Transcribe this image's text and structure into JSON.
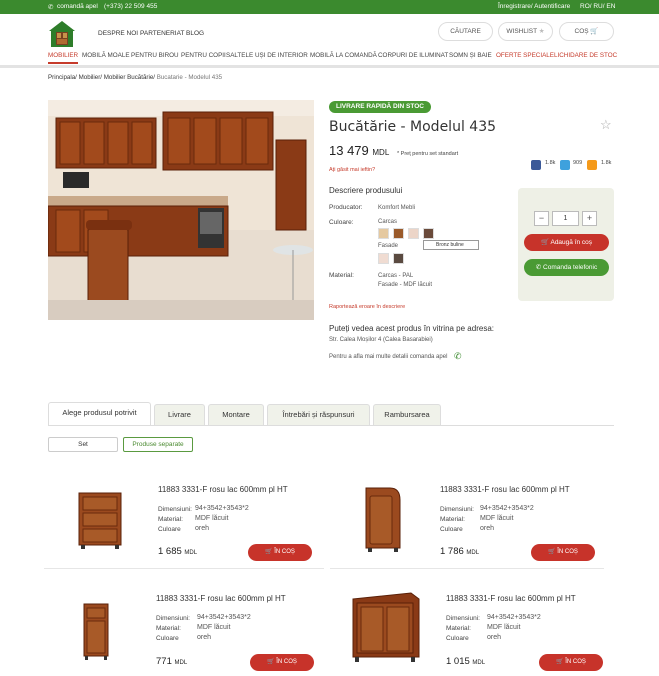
{
  "topbar": {
    "callback": "comandă apel",
    "phone": "(+373) 22 509 455",
    "auth": "Înregistrare/ Autentificare",
    "langs": "RO/ RU/ EN"
  },
  "header": {
    "links": [
      "DESPRE NOI",
      "PARTENERIAT",
      "BLOG"
    ],
    "search": "CĂUTARE",
    "wishlist": "WISHLIST",
    "cart": "COȘ"
  },
  "nav": [
    "MOBILIER",
    "MOBILĂ MOALE",
    "PENTRU BIROU",
    "PENTRU COPII",
    "SALTELE",
    "UȘI DE INTERIOR",
    "MOBILĂ LA COMANDĂ",
    "CORPURI DE ILUMINAT",
    "SOMN ȘI BAIE",
    "OFERTE SPECIALE",
    "LICHIDARE DE STOC"
  ],
  "breadcrumb": [
    "Principala/",
    "Mobilier/",
    "Mobilier Bucătărie/",
    "Bucatarie - Modelul 435"
  ],
  "product": {
    "badge": "LIVRARE RAPIDĂ DIN STOC",
    "title": "Bucătărie - Modelul 435",
    "price": "13 479",
    "currency": "MDL",
    "price_note": "* Preț pentru set standart",
    "cheaper": "Ați găsit mai ieftin?",
    "social": {
      "fb": "1.8k",
      "tw": "909",
      "ok": "1.8k"
    },
    "desc_title": "Descriere produsului",
    "producer_label": "Producator:",
    "producer": "Komfort Mebli",
    "color_label": "Culoare:",
    "carcas": "Carcas",
    "fasade": "Fasade",
    "tooltip": "Bronz buline",
    "material_label": "Material:",
    "material_line1": "Carcas - PAL",
    "material_line2": "Fasade - MDF lăcuit",
    "report": "Raportează eroare în descriere",
    "showroom_title": "Puteți vedea acest produs în vitrina pe adresa:",
    "showroom_addr": "Str. Calea Moșilor 4 (Calea Basarabiei)",
    "more_info": "Pentru a afla mai multe detalii comanda apel",
    "qty": "1",
    "add_to_cart": "Adaugă în coș",
    "order_phone": "Comanda telefonic",
    "swatch_colors": {
      "carcas": [
        "#e5c9a0",
        "#9a5a2a",
        "#ecd5c8",
        "#6a4a3a"
      ],
      "fasade": [
        "#f0dcd2",
        "#5a4a40"
      ]
    }
  },
  "tabs": [
    "Alege produsul potrivit",
    "Livrare",
    "Montare",
    "Întrebări și răspunsuri",
    "Rambursarea"
  ],
  "subtabs": [
    "Set",
    "Produse separate"
  ],
  "card_labels": {
    "dim": "Dimensiuni:",
    "mat": "Material:",
    "color": "Culoare",
    "btn": "ÎN COȘ",
    "cur": "MDL"
  },
  "cards": [
    {
      "title": "11883 3331-F rosu lac 600mm pl HT",
      "dim": "94+3542+3543*2",
      "mat": "MDF lăcuit",
      "color": "oreh",
      "price": "1 685"
    },
    {
      "title": "11883 3331-F rosu lac 600mm pl HT",
      "dim": "94+3542+3543*2",
      "mat": "MDF lăcuit",
      "color": "oreh",
      "price": "1 786"
    },
    {
      "title": "11883 3331-F rosu lac 600mm pl HT",
      "dim": "94+3542+3543*2",
      "mat": "MDF lăcuit",
      "color": "oreh",
      "price": "771"
    },
    {
      "title": "11883 3331-F rosu lac 600mm pl HT",
      "dim": "94+3542+3543*2",
      "mat": "MDF lăcuit",
      "color": "oreh",
      "price": "1 015"
    }
  ],
  "colors": {
    "green": "#3b8a2e",
    "red": "#c7332a",
    "wood": "#9b4a1f"
  }
}
